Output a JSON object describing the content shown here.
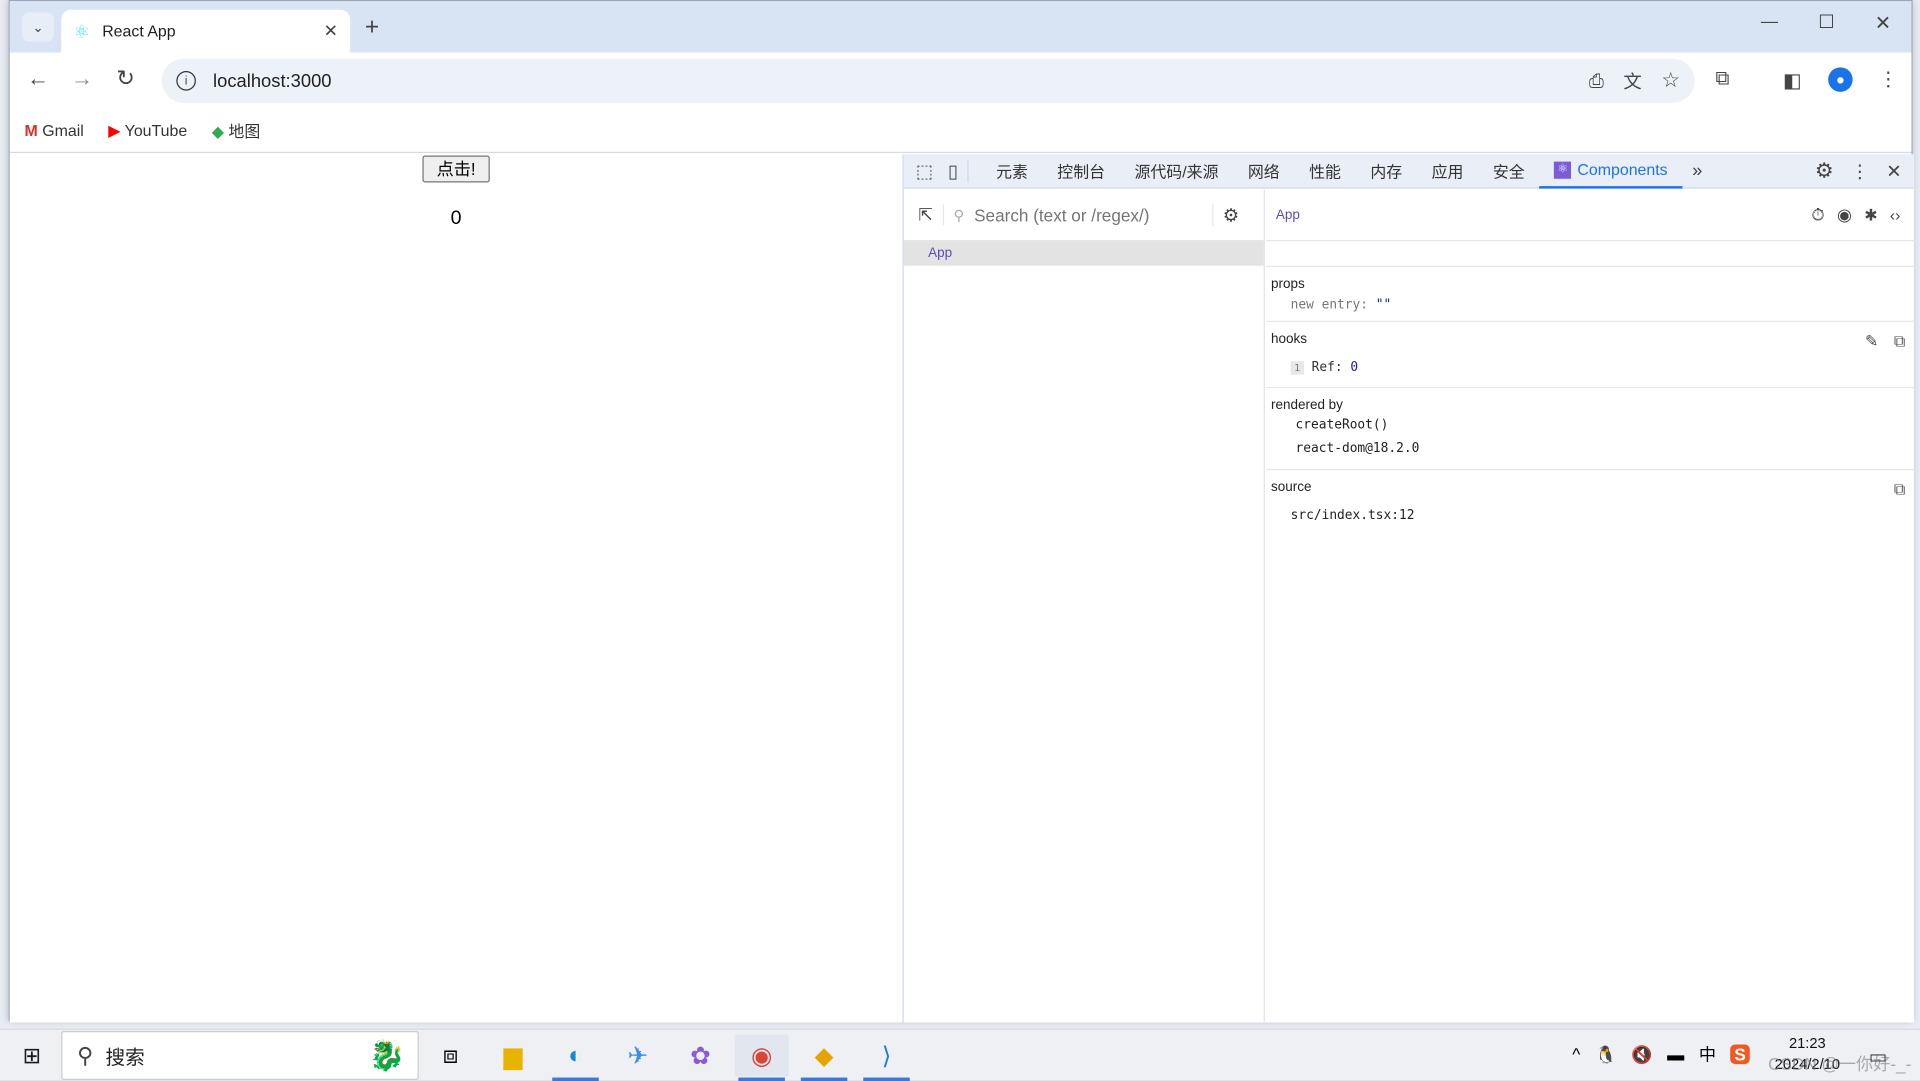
{
  "browser": {
    "tab_title": "React App",
    "url": "localhost:3000",
    "bookmarks": [
      {
        "label": "Gmail"
      },
      {
        "label": "YouTube"
      },
      {
        "label": "地图"
      }
    ]
  },
  "page": {
    "button_label": "点击!",
    "count": "0"
  },
  "devtools": {
    "tabs": [
      "元素",
      "控制台",
      "源代码/来源",
      "网络",
      "性能",
      "内存",
      "应用",
      "安全"
    ],
    "active_tab": "Components",
    "search_placeholder": "Search (text or /regex/)",
    "tree": [
      {
        "label": "App"
      }
    ],
    "selected_component": "App",
    "props": {
      "heading": "props",
      "key": "new entry",
      "value": "\"\""
    },
    "hooks": {
      "heading": "hooks",
      "index": "1",
      "key": "Ref",
      "value": "0"
    },
    "rendered_by": {
      "heading": "rendered by",
      "items": [
        "createRoot()",
        "react-dom@18.2.0"
      ]
    },
    "source": {
      "heading": "source",
      "value": "src/index.tsx:12"
    },
    "accent": "#1a73e8",
    "component_color": "#5f4bb6"
  },
  "taskbar": {
    "search_label": "搜索",
    "time": "21:23",
    "date": "2024/2/10",
    "ime": "中",
    "watermark": "CSDN @一你好-_-"
  }
}
